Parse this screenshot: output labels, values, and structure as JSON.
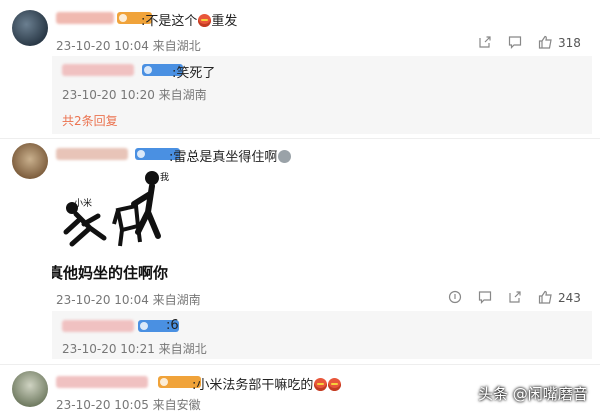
{
  "comments": [
    {
      "text": ":不是这个",
      "text_tail": "重发",
      "meta": "23-10-20 10:04 来自湖北",
      "likes": "318",
      "replies": [
        {
          "text": ":笑死了",
          "meta": "23-10-20 10:20 来自湖南"
        }
      ],
      "more_replies": "共2条回复"
    },
    {
      "text": ":雷总是真坐得住啊",
      "image_texts": {
        "left_label": "小米",
        "right_label": "我",
        "caption": "真他妈坐的住啊你"
      },
      "meta": "23-10-20 10:04 来自湖南",
      "likes": "243",
      "replies": [
        {
          "text": ":6",
          "meta": "23-10-20 10:21 来自湖北"
        }
      ]
    },
    {
      "text": ":小米法务部干嘛吃的",
      "meta": "23-10-20 10:05 来自安徽"
    }
  ],
  "watermark": "头条 @闲嘴磨音",
  "colors": {
    "badge_orange": "#f0a33a",
    "badge_blue": "#4a90e2",
    "reply_link": "#eb7350"
  }
}
